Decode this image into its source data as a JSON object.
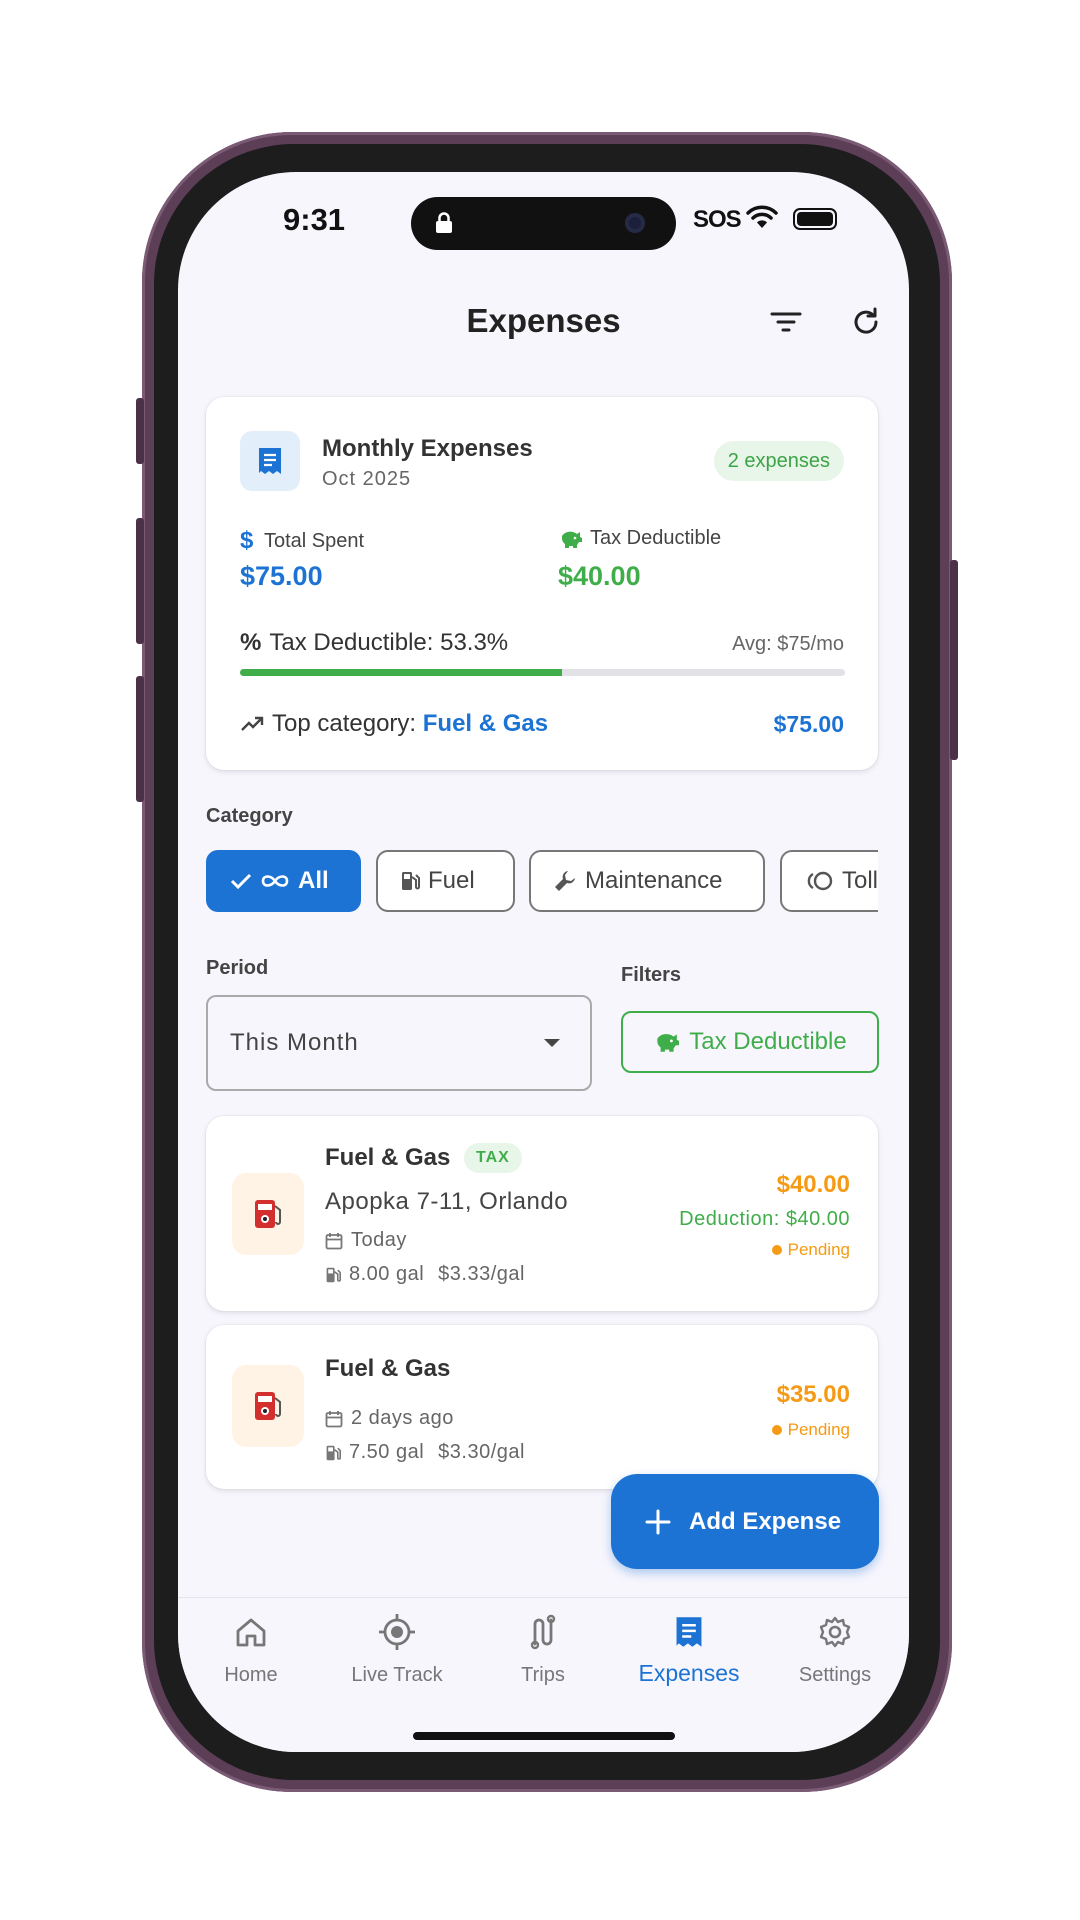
{
  "status_bar": {
    "time": "9:31",
    "sos": "SOS"
  },
  "header": {
    "title": "Expenses"
  },
  "summary": {
    "title": "Monthly Expenses",
    "period": "Oct 2025",
    "count_badge": "2 expenses",
    "total_spent_label": "Total Spent",
    "total_spent_value": "$75.00",
    "tax_deductible_label": "Tax Deductible",
    "tax_deductible_value": "$40.00",
    "tax_pct_label": "Tax Deductible: 53.3%",
    "tax_pct_fraction": 0.533,
    "avg": "Avg: $75/mo",
    "top_category_prefix": "Top category: ",
    "top_category_name": "Fuel & Gas",
    "top_category_amount": "$75.00"
  },
  "category": {
    "label": "Category",
    "chips": [
      {
        "label": "All",
        "icon": "infinity-icon",
        "selected": true
      },
      {
        "label": "Fuel",
        "icon": "fuel-pump-icon",
        "selected": false
      },
      {
        "label": "Maintenance",
        "icon": "wrench-icon",
        "selected": false
      },
      {
        "label": "Toll",
        "icon": "toll-icon",
        "selected": false
      }
    ]
  },
  "period": {
    "label": "Period",
    "selected": "This Month"
  },
  "filters": {
    "label": "Filters",
    "tax_deductible": "Tax Deductible"
  },
  "expenses": [
    {
      "category": "Fuel & Gas",
      "tax_badge": "TAX",
      "location": "Apopka 7-11, Orlando",
      "date": "Today",
      "gallons": "8.00 gal",
      "price_per_gal": "$3.33/gal",
      "amount": "$40.00",
      "deduction": "Deduction: $40.00",
      "status": "Pending"
    },
    {
      "category": "Fuel & Gas",
      "date": "2 days ago",
      "gallons": "7.50 gal",
      "price_per_gal": "$3.30/gal",
      "amount": "$35.00",
      "status": "Pending"
    }
  ],
  "fab": {
    "label": "Add Expense"
  },
  "bottom_nav": [
    {
      "label": "Home",
      "icon": "home-icon"
    },
    {
      "label": "Live Track",
      "icon": "location-target-icon"
    },
    {
      "label": "Trips",
      "icon": "route-icon"
    },
    {
      "label": "Expenses",
      "icon": "receipt-icon",
      "active": true
    },
    {
      "label": "Settings",
      "icon": "gear-icon"
    }
  ],
  "colors": {
    "primary": "#1c73d4",
    "success": "#3fae4a",
    "warning": "#f59a14"
  }
}
